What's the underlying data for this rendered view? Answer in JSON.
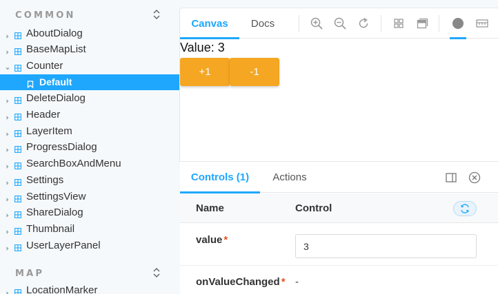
{
  "sidebar": {
    "sections": [
      {
        "title": "COMMON",
        "items": [
          {
            "label": "AboutDialog"
          },
          {
            "label": "BaseMapList"
          },
          {
            "label": "Counter",
            "expanded": true
          },
          {
            "label": "Default",
            "story": true,
            "selected": true
          },
          {
            "label": "DeleteDialog"
          },
          {
            "label": "Header"
          },
          {
            "label": "LayerItem"
          },
          {
            "label": "ProgressDialog"
          },
          {
            "label": "SearchBoxAndMenu"
          },
          {
            "label": "Settings"
          },
          {
            "label": "SettingsView"
          },
          {
            "label": "ShareDialog"
          },
          {
            "label": "Thumbnail"
          },
          {
            "label": "UserLayerPanel"
          }
        ]
      },
      {
        "title": "MAP",
        "items": [
          {
            "label": "LocationMarker"
          }
        ]
      }
    ]
  },
  "toolbar": {
    "tabs": [
      "Canvas",
      "Docs"
    ],
    "tools": [
      "zoom-in-icon",
      "zoom-out-icon",
      "reset-zoom-icon",
      "grid-icon",
      "background-icon",
      "circle-icon",
      "ruler-icon"
    ]
  },
  "preview": {
    "value_text": "Value: 3",
    "buttons": [
      "+1",
      "-1"
    ],
    "button_color": "#f5a623"
  },
  "addons": {
    "tabs": [
      "Controls (1)",
      "Actions"
    ],
    "columns": {
      "name": "Name",
      "control": "Control"
    },
    "rows": [
      {
        "name": "value",
        "required": "*",
        "value": "3"
      },
      {
        "name": "onValueChanged",
        "required": "*",
        "value": "-"
      }
    ]
  },
  "colors": {
    "accent": "#1ea7fd",
    "required": "#e6521f",
    "sidebar_bg": "#f6f9fc"
  }
}
